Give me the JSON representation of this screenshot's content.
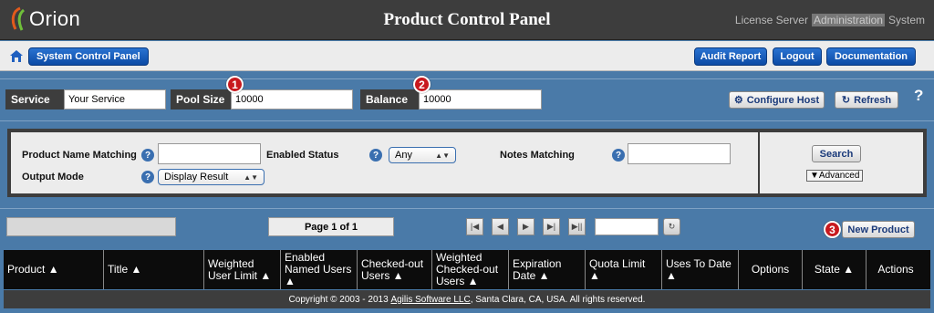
{
  "header": {
    "logo_text": "Orion",
    "title": "Product Control Panel",
    "crumbs": [
      "License Server",
      "Administration",
      "System"
    ]
  },
  "nav": {
    "system_control_panel": "System Control Panel",
    "audit_report": "Audit Report",
    "logout": "Logout",
    "documentation": "Documentation"
  },
  "service_bar": {
    "service_label": "Service",
    "service_value": "Your Service",
    "pool_size_label": "Pool Size",
    "pool_size_value": "10000",
    "balance_label": "Balance",
    "balance_value": "10000",
    "configure_host": "Configure Host",
    "refresh": "Refresh",
    "help": "?"
  },
  "markers": [
    "1",
    "2",
    "3"
  ],
  "search": {
    "product_name_label": "Product Name Matching",
    "product_name_value": "",
    "enabled_status_label": "Enabled Status",
    "enabled_status_value": "Any",
    "notes_label": "Notes Matching",
    "notes_value": "",
    "output_mode_label": "Output Mode",
    "output_mode_value": "Display Result",
    "search_button": "Search",
    "advanced": "▼Advanced"
  },
  "pager": {
    "page_text": "Page 1 of 1",
    "page_input": "",
    "new_product": "New Product"
  },
  "table": {
    "columns": [
      {
        "line1": "Product ▲",
        "line2": ""
      },
      {
        "line1": "Title ▲",
        "line2": ""
      },
      {
        "line1": "Weighted",
        "line2": "User Limit ▲"
      },
      {
        "line1": "Enabled",
        "line2": "Named Users ▲"
      },
      {
        "line1": "Checked-out",
        "line2": "Users ▲"
      },
      {
        "line1": "Weighted",
        "line2": "Checked-out Users ▲"
      },
      {
        "line1": "Expiration",
        "line2": "Date ▲"
      },
      {
        "line1": "Quota Limit",
        "line2": "▲"
      },
      {
        "line1": "Uses To Date",
        "line2": "▲"
      },
      {
        "line1": "Options",
        "line2": ""
      },
      {
        "line1": "State ▲",
        "line2": ""
      },
      {
        "line1": "Actions",
        "line2": ""
      }
    ]
  },
  "footer": {
    "prefix": "Copyright © 2003 - 2013 ",
    "link": "Agilis Software LLC",
    "suffix": ", Santa Clara, CA, USA. All rights reserved."
  },
  "colors": {
    "page_bg": "#4a7aa8",
    "header_bg": "#3d3d3d",
    "button_blue": "#0b4aa5",
    "marker_red": "#c8191e"
  }
}
